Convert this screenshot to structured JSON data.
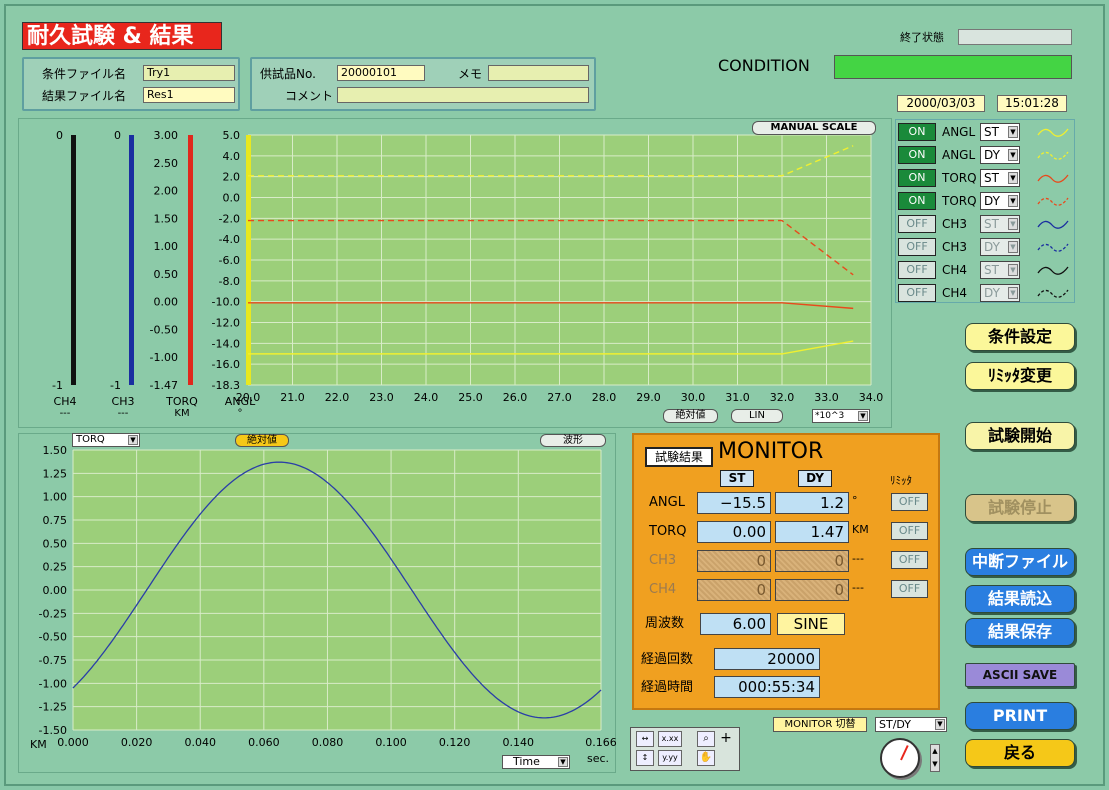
{
  "title": "耐久試験 & 結果",
  "files": {
    "cond_label": "条件ファイル名",
    "cond_value": "Try1",
    "result_label": "結果ファイル名",
    "result_value": "Res1"
  },
  "specimen": {
    "no_label": "供試品No.",
    "no_value": "20000101",
    "memo_label": "メモ",
    "memo_value": "",
    "comment_label": "コメント",
    "comment_value": ""
  },
  "status": {
    "end_label": "終了状態",
    "end_value": "",
    "condition_label": "CONDITION",
    "date": "2000/03/03",
    "time": "15:01:28"
  },
  "top_chart": {
    "manual_scale": "MANUAL SCALE",
    "abs_button": "絶対値",
    "lin_button": "LIN",
    "x_multiplier": "*10^3",
    "axes": [
      {
        "name": "CH4",
        "unit": "---",
        "top": "0",
        "bottom": "-1",
        "color": "#111111"
      },
      {
        "name": "CH3",
        "unit": "---",
        "top": "0",
        "bottom": "-1",
        "color": "#1a2ea0"
      },
      {
        "name": "TORQ",
        "unit": "KM",
        "top": "3.00",
        "bottom": "-1.47",
        "color": "#e0281c"
      },
      {
        "name": "ANGL",
        "unit": "°",
        "top": "5.0",
        "bottom": "-18.3",
        "color": "#e8e820"
      }
    ],
    "torq_ticks": [
      "3.00",
      "2.50",
      "2.00",
      "1.50",
      "1.00",
      "0.50",
      "0.00",
      "-0.50",
      "-1.00",
      "-1.47"
    ],
    "angl_ticks": [
      "5.0",
      "4.0",
      "2.0",
      "0.0",
      "-2.0",
      "-4.0",
      "-6.0",
      "-8.0",
      "-10.0",
      "-12.0",
      "-14.0",
      "-16.0",
      "-18.3"
    ],
    "x_ticks": [
      "20.0",
      "21.0",
      "22.0",
      "23.0",
      "24.0",
      "25.0",
      "26.0",
      "27.0",
      "28.0",
      "29.0",
      "30.0",
      "31.0",
      "32.0",
      "33.0",
      "34.0"
    ]
  },
  "channels": [
    {
      "state": "ON",
      "name": "ANGL",
      "mode": "ST",
      "enabled": true
    },
    {
      "state": "ON",
      "name": "ANGL",
      "mode": "DY",
      "enabled": true
    },
    {
      "state": "ON",
      "name": "TORQ",
      "mode": "ST",
      "enabled": true
    },
    {
      "state": "ON",
      "name": "TORQ",
      "mode": "DY",
      "enabled": true
    },
    {
      "state": "OFF",
      "name": "CH3",
      "mode": "ST",
      "enabled": false
    },
    {
      "state": "OFF",
      "name": "CH3",
      "mode": "DY",
      "enabled": false
    },
    {
      "state": "OFF",
      "name": "CH4",
      "mode": "ST",
      "enabled": false
    },
    {
      "state": "OFF",
      "name": "CH4",
      "mode": "DY",
      "enabled": false
    }
  ],
  "side_buttons": {
    "condition_setting": "条件設定",
    "limiter_change": "ﾘﾐｯﾀ変更",
    "start_test": "試験開始",
    "stop_test": "試験停止",
    "interrupt_file": "中断ファイル",
    "load_result": "結果読込",
    "save_result": "結果保存",
    "ascii_save": "ASCII SAVE",
    "print": "PRINT",
    "back": "戻る"
  },
  "bottom_chart": {
    "channel_select": "TORQ",
    "abs_button": "絶対値",
    "wave_button": "波形",
    "y_unit": "KM",
    "x_unit": "sec.",
    "x_select": "Time",
    "y_ticks": [
      "1.50",
      "1.25",
      "1.00",
      "0.75",
      "0.50",
      "0.25",
      "0.00",
      "-0.25",
      "-0.50",
      "-0.75",
      "-1.00",
      "-1.25",
      "-1.50"
    ],
    "x_ticks": [
      "0.000",
      "0.020",
      "0.040",
      "0.060",
      "0.080",
      "0.100",
      "0.120",
      "0.140",
      "0.166"
    ]
  },
  "monitor": {
    "result_button": "試験結果",
    "title": "MONITOR",
    "st": "ST",
    "dy": "DY",
    "limiter": "ﾘﾐｯﾀ",
    "rows": [
      {
        "name": "ANGL",
        "st": "−15.5",
        "dy": "1.2",
        "unit": "°",
        "limiter": "OFF",
        "active": true
      },
      {
        "name": "TORQ",
        "st": "0.00",
        "dy": "1.47",
        "unit": "KM",
        "limiter": "OFF",
        "active": true
      },
      {
        "name": "CH3",
        "st": "0",
        "dy": "0",
        "unit": "---",
        "limiter": "OFF",
        "active": false
      },
      {
        "name": "CH4",
        "st": "0",
        "dy": "0",
        "unit": "---",
        "limiter": "OFF",
        "active": false
      }
    ],
    "freq_label": "周波数",
    "freq_value": "6.00",
    "wave_value": "SINE",
    "cycles_label": "経過回数",
    "cycles_value": "20000",
    "time_label": "経過時間",
    "time_value": "000:55:34",
    "switch_label": "MONITOR 切替",
    "switch_value": "ST/DY"
  },
  "chart_data": [
    {
      "type": "line",
      "title": "",
      "x": [
        20.0,
        32.0,
        33.6
      ],
      "xlim": [
        20.0,
        34.0
      ],
      "series": [
        {
          "name": "ANGL ST",
          "values": [
            -15.4,
            -15.4,
            -14.2
          ]
        },
        {
          "name": "ANGL DY",
          "values": [
            1.2,
            1.2,
            4.0
          ]
        },
        {
          "name": "TORQ ST",
          "values": [
            0.0,
            0.0,
            -0.1
          ]
        },
        {
          "name": "TORQ DY",
          "values": [
            1.47,
            1.47,
            0.5
          ]
        }
      ]
    },
    {
      "type": "line",
      "title": "",
      "x_range": [
        0.0,
        0.166
      ],
      "ylim": [
        -1.5,
        1.5
      ],
      "series": [
        {
          "name": "TORQ",
          "amplitude": 1.37,
          "frequency": 6.0,
          "phase_deg": -50
        }
      ]
    }
  ],
  "colors": {
    "angl": "#f0f030",
    "torq": "#e84a1c",
    "ch3": "#1a2ea0",
    "ch4": "#111111",
    "plot_bg": "#9ccf7a",
    "grid": "#d8ecc8"
  }
}
